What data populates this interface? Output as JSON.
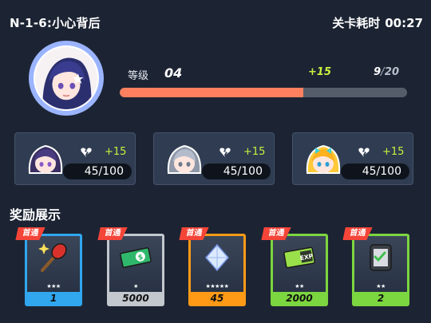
{
  "header": {
    "stage_title": "N-1-6:小心背后",
    "timer_label": "关卡耗时",
    "timer_value": "00:27"
  },
  "player": {
    "level_label": "等级",
    "level_value": "04",
    "level_gain": "+15",
    "exp_current": "9",
    "exp_max": "20",
    "exp_progress_fraction": 0.64
  },
  "characters": [
    {
      "name_icon": "purple-hair-character-avatar",
      "gain": "+15",
      "affinity": "45/100"
    },
    {
      "name_icon": "silver-hair-character-avatar",
      "gain": "+15",
      "affinity": "45/100"
    },
    {
      "name_icon": "blonde-hair-character-avatar",
      "gain": "+15",
      "affinity": "45/100"
    }
  ],
  "rewards_title": "奖励展示",
  "rewards": [
    {
      "badge": "首通",
      "stars": "★★★",
      "count": "1",
      "rarity_color": "#30a7ef",
      "icon": "sparkle-wand-icon"
    },
    {
      "badge": "首通",
      "stars": "★",
      "count": "5000",
      "rarity_color": "#c3c7ce",
      "icon": "cash-ticket-icon"
    },
    {
      "badge": "首通",
      "stars": "★★★★★",
      "count": "45",
      "rarity_color": "#ff9a17",
      "icon": "crystal-icon"
    },
    {
      "badge": "首通",
      "stars": "★★",
      "count": "2000",
      "rarity_color": "#7cd63f",
      "icon": "exp-ticket-icon",
      "icon_text": "EXP"
    },
    {
      "badge": "首通",
      "stars": "★★",
      "count": "2",
      "rarity_color": "#7cd63f",
      "icon": "checklist-device-icon"
    }
  ]
}
